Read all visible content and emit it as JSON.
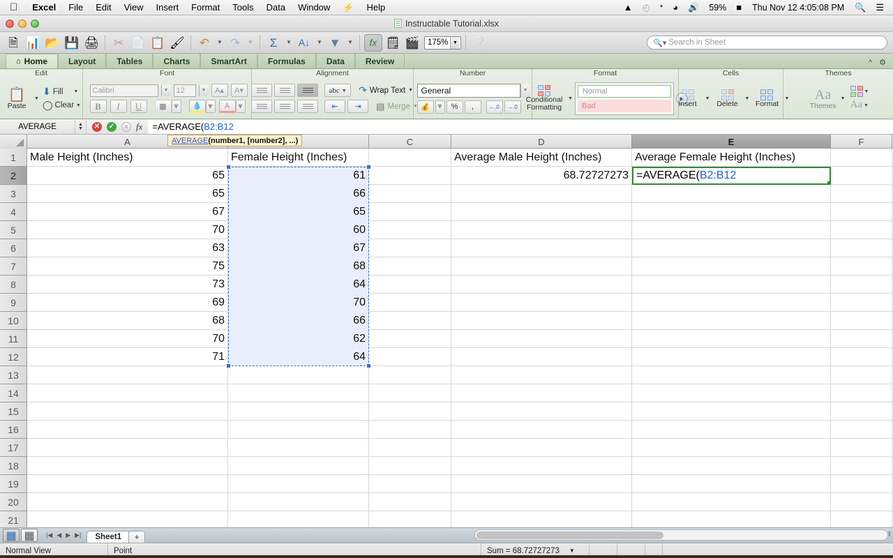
{
  "macbar": {
    "apple": "",
    "app_name": "Excel",
    "menus": [
      "File",
      "Edit",
      "View",
      "Insert",
      "Format",
      "Tools",
      "Data",
      "Window"
    ],
    "bolt_icon": "bolt-icon",
    "help": "Help",
    "status_icons": [
      "drive-icon",
      "timemachine-icon",
      "bluetooth-icon",
      "wifi-icon",
      "volume-icon"
    ],
    "battery_percent": "59%",
    "clock": "Thu Nov 12  4:05:08 PM",
    "spotlight_icon": "search-icon",
    "notification_icon": "notification-center-icon"
  },
  "titlebar": {
    "document": "Instructable Tutorial.xlsx"
  },
  "toolbar": {
    "buttons": [
      {
        "name": "new-workbook-button",
        "glyph": "🗎"
      },
      {
        "name": "open-recent-button",
        "glyph": "🧮"
      },
      {
        "name": "open-button",
        "glyph": "📂"
      },
      {
        "name": "save-button",
        "glyph": "💾"
      },
      {
        "name": "print-button",
        "glyph": "🖨"
      },
      {
        "name": "cut-button",
        "glyph": "✂"
      },
      {
        "name": "copy-button",
        "glyph": "🗐"
      },
      {
        "name": "paste-button",
        "glyph": "📋"
      },
      {
        "name": "format-painter-button",
        "glyph": "🖌"
      },
      {
        "name": "undo-button",
        "glyph": "↺"
      },
      {
        "name": "redo-button",
        "glyph": "↻"
      },
      {
        "name": "autosum-button",
        "glyph": "Σ"
      },
      {
        "name": "sort-button",
        "glyph": "↓"
      },
      {
        "name": "filter-button",
        "glyph": "▽"
      },
      {
        "name": "formula-builder-button",
        "glyph": "fx"
      },
      {
        "name": "toolbox-button",
        "glyph": "🗒"
      },
      {
        "name": "media-browser-button",
        "glyph": "🎞"
      }
    ],
    "zoom_value": "175%",
    "help_icon": "help-icon"
  },
  "search": {
    "placeholder": "Search in Sheet",
    "icon": "search-icon"
  },
  "ribbon": {
    "tabs": [
      {
        "label": "Home",
        "active": true,
        "icon": "home-icon"
      },
      {
        "label": "Layout",
        "active": false
      },
      {
        "label": "Tables",
        "active": false
      },
      {
        "label": "Charts",
        "active": false
      },
      {
        "label": "SmartArt",
        "active": false
      },
      {
        "label": "Formulas",
        "active": false
      },
      {
        "label": "Data",
        "active": false
      },
      {
        "label": "Review",
        "active": false
      }
    ],
    "collapse_icon": "chevron-up-icon",
    "settings_icon": "gear-icon",
    "groups": {
      "edit": {
        "label": "Edit",
        "paste_label": "Paste",
        "fill_label": "Fill",
        "clear_label": "Clear"
      },
      "font": {
        "label": "Font",
        "family": "Calibri",
        "size": "12",
        "grow_label": "A",
        "shrink_label": "A",
        "bold": "B",
        "italic": "I",
        "underline": "U",
        "borders_icon": "borders-icon",
        "fill_color_icon": "fill-color-icon",
        "font_color_icon": "font-color-icon"
      },
      "alignment": {
        "label": "Alignment",
        "abc_label": "abc",
        "wrap_label": "Wrap Text",
        "merge_label": "Merge"
      },
      "number": {
        "label": "Number",
        "format": "General",
        "currency_icon": "currency-icon",
        "percent_label": "%",
        "comma_label": ",",
        "increase_decimal": ".00",
        "decrease_decimal": ".00"
      },
      "format": {
        "label": "Format",
        "conditional_label": "Conditional Formatting",
        "style_normal": "Normal",
        "style_bad": "Bad"
      },
      "cells": {
        "label": "Cells",
        "insert_label": "Insert",
        "delete_label": "Delete",
        "format_label": "Format"
      },
      "themes": {
        "label": "Themes",
        "themes_label": "Themes",
        "aa_label": "Aa"
      }
    }
  },
  "formula_bar": {
    "name_box": "AVERAGE",
    "cancel_icon": "cancel-icon",
    "accept_icon": "accept-icon",
    "enter_icon": "enter-icon",
    "fx_icon": "function-icon",
    "formula_prefix": "=AVERAGE(",
    "formula_ref": "B2:B12",
    "tooltip_fn": "AVERAGE",
    "tooltip_args": "(number1, [number2], ...)"
  },
  "grid": {
    "columns": [
      "A",
      "B",
      "C",
      "D",
      "E",
      "F"
    ],
    "selected_column": "E",
    "selected_row": "2",
    "rows": [
      "1",
      "2",
      "3",
      "4",
      "5",
      "6",
      "7",
      "8",
      "9",
      "10",
      "11",
      "12",
      "13",
      "14",
      "15",
      "16",
      "17",
      "18",
      "19",
      "20",
      "21"
    ],
    "cells": {
      "A1": "Male Height (Inches)",
      "B1": "Female Height (Inches)",
      "D1": "Average Male Height (Inches)",
      "E1": "Average Female Height (Inches)",
      "D2": "68.72727273"
    },
    "male_heights": [
      "65",
      "65",
      "67",
      "70",
      "63",
      "75",
      "73",
      "69",
      "68",
      "70",
      "71"
    ],
    "female_heights": [
      "61",
      "66",
      "65",
      "60",
      "67",
      "68",
      "64",
      "70",
      "66",
      "62",
      "64"
    ],
    "edit_cell_prefix": "=AVERAGE(",
    "edit_cell_ref": "B2:B12",
    "selection_range": "B2:B12"
  },
  "bottom": {
    "sheet_tab": "Sheet1",
    "add_sheet": "+",
    "normal_view_icon": "normal-view-icon",
    "layout_view_icon": "page-layout-view-icon",
    "nav_first": "|◀",
    "nav_prev": "◀",
    "nav_next": "▶",
    "nav_last": "▶|"
  },
  "status": {
    "view_mode": "Normal View",
    "mode": "Point",
    "sum_label": "Sum = 68.72727273",
    "dropdown_icon": "chevron-down-icon"
  },
  "colors": {
    "ribbon_green": "#dde6d8",
    "tab_active": "#e2ecdc",
    "selection_blue": "#e8eefb",
    "edit_border_green": "#2e8b36",
    "formula_ref_blue": "#1e5fd6"
  }
}
